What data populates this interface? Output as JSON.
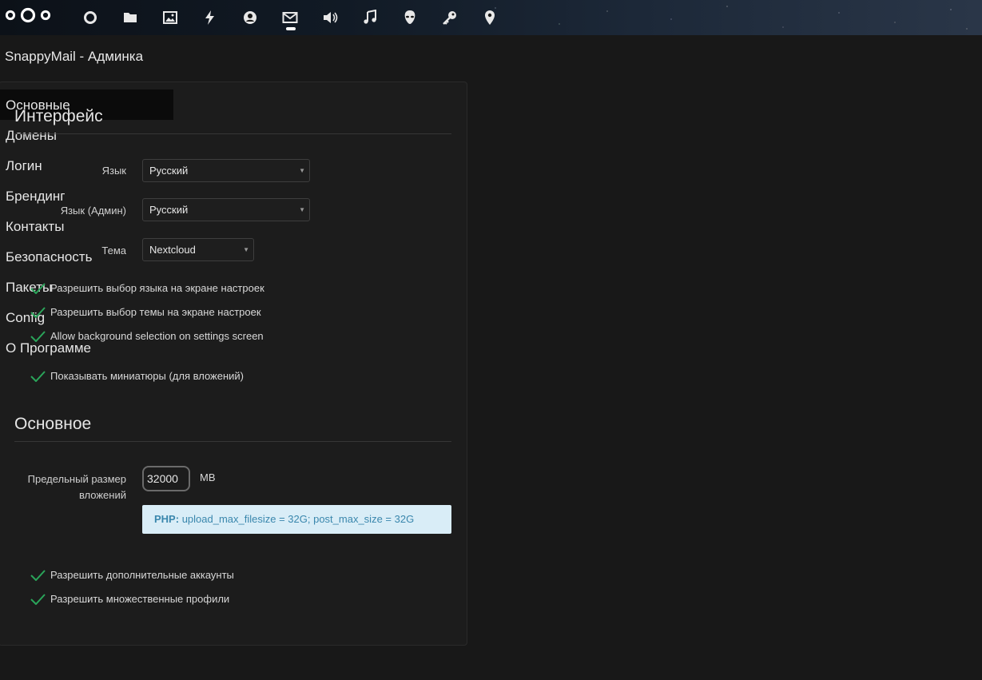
{
  "app": {
    "page_title": "SnappyMail - Админка"
  },
  "header": {
    "nav_icons": [
      "dashboard-icon",
      "files-icon",
      "photos-icon",
      "activity-icon",
      "contacts-icon",
      "mail-icon",
      "audio-icon",
      "music-icon",
      "alien-icon",
      "key-icon",
      "maps-icon"
    ],
    "active_icon": "mail-icon"
  },
  "sidebar": {
    "items": [
      {
        "label": "Основные",
        "active": true
      },
      {
        "label": "Домены"
      },
      {
        "label": "Логин"
      },
      {
        "label": "Брендинг"
      },
      {
        "label": "Контакты"
      },
      {
        "label": "Безопасность"
      },
      {
        "label": "Пакеты"
      },
      {
        "label": "Config"
      },
      {
        "label": "О Программе"
      }
    ]
  },
  "interface": {
    "title": "Интерфейс",
    "language_label": "Язык",
    "language_value": "Русский",
    "admin_language_label": "Язык (Админ)",
    "admin_language_value": "Русский",
    "theme_label": "Тема",
    "theme_value": "Nextcloud",
    "checks": [
      "Разрешить выбор языка на экране настроек",
      "Разрешить выбор темы на экране настроек",
      "Allow background selection on settings screen",
      "Показывать миниатюры (для вложений)"
    ]
  },
  "general": {
    "title": "Основное",
    "attachment_limit_label_1": "Предельный размер",
    "attachment_limit_label_2": "вложений",
    "attachment_limit_value": "32000",
    "attachment_limit_unit": "MB",
    "php_label": "PHP:",
    "php_info": "upload_max_filesize = 32G; post_max_size = 32G",
    "checks": [
      "Разрешить дополнительные аккаунты",
      "Разрешить множественные профили"
    ]
  },
  "colors": {
    "accent_check": "#2aa55a",
    "info_bg": "#d9edf7",
    "info_text": "#3a87ad"
  }
}
